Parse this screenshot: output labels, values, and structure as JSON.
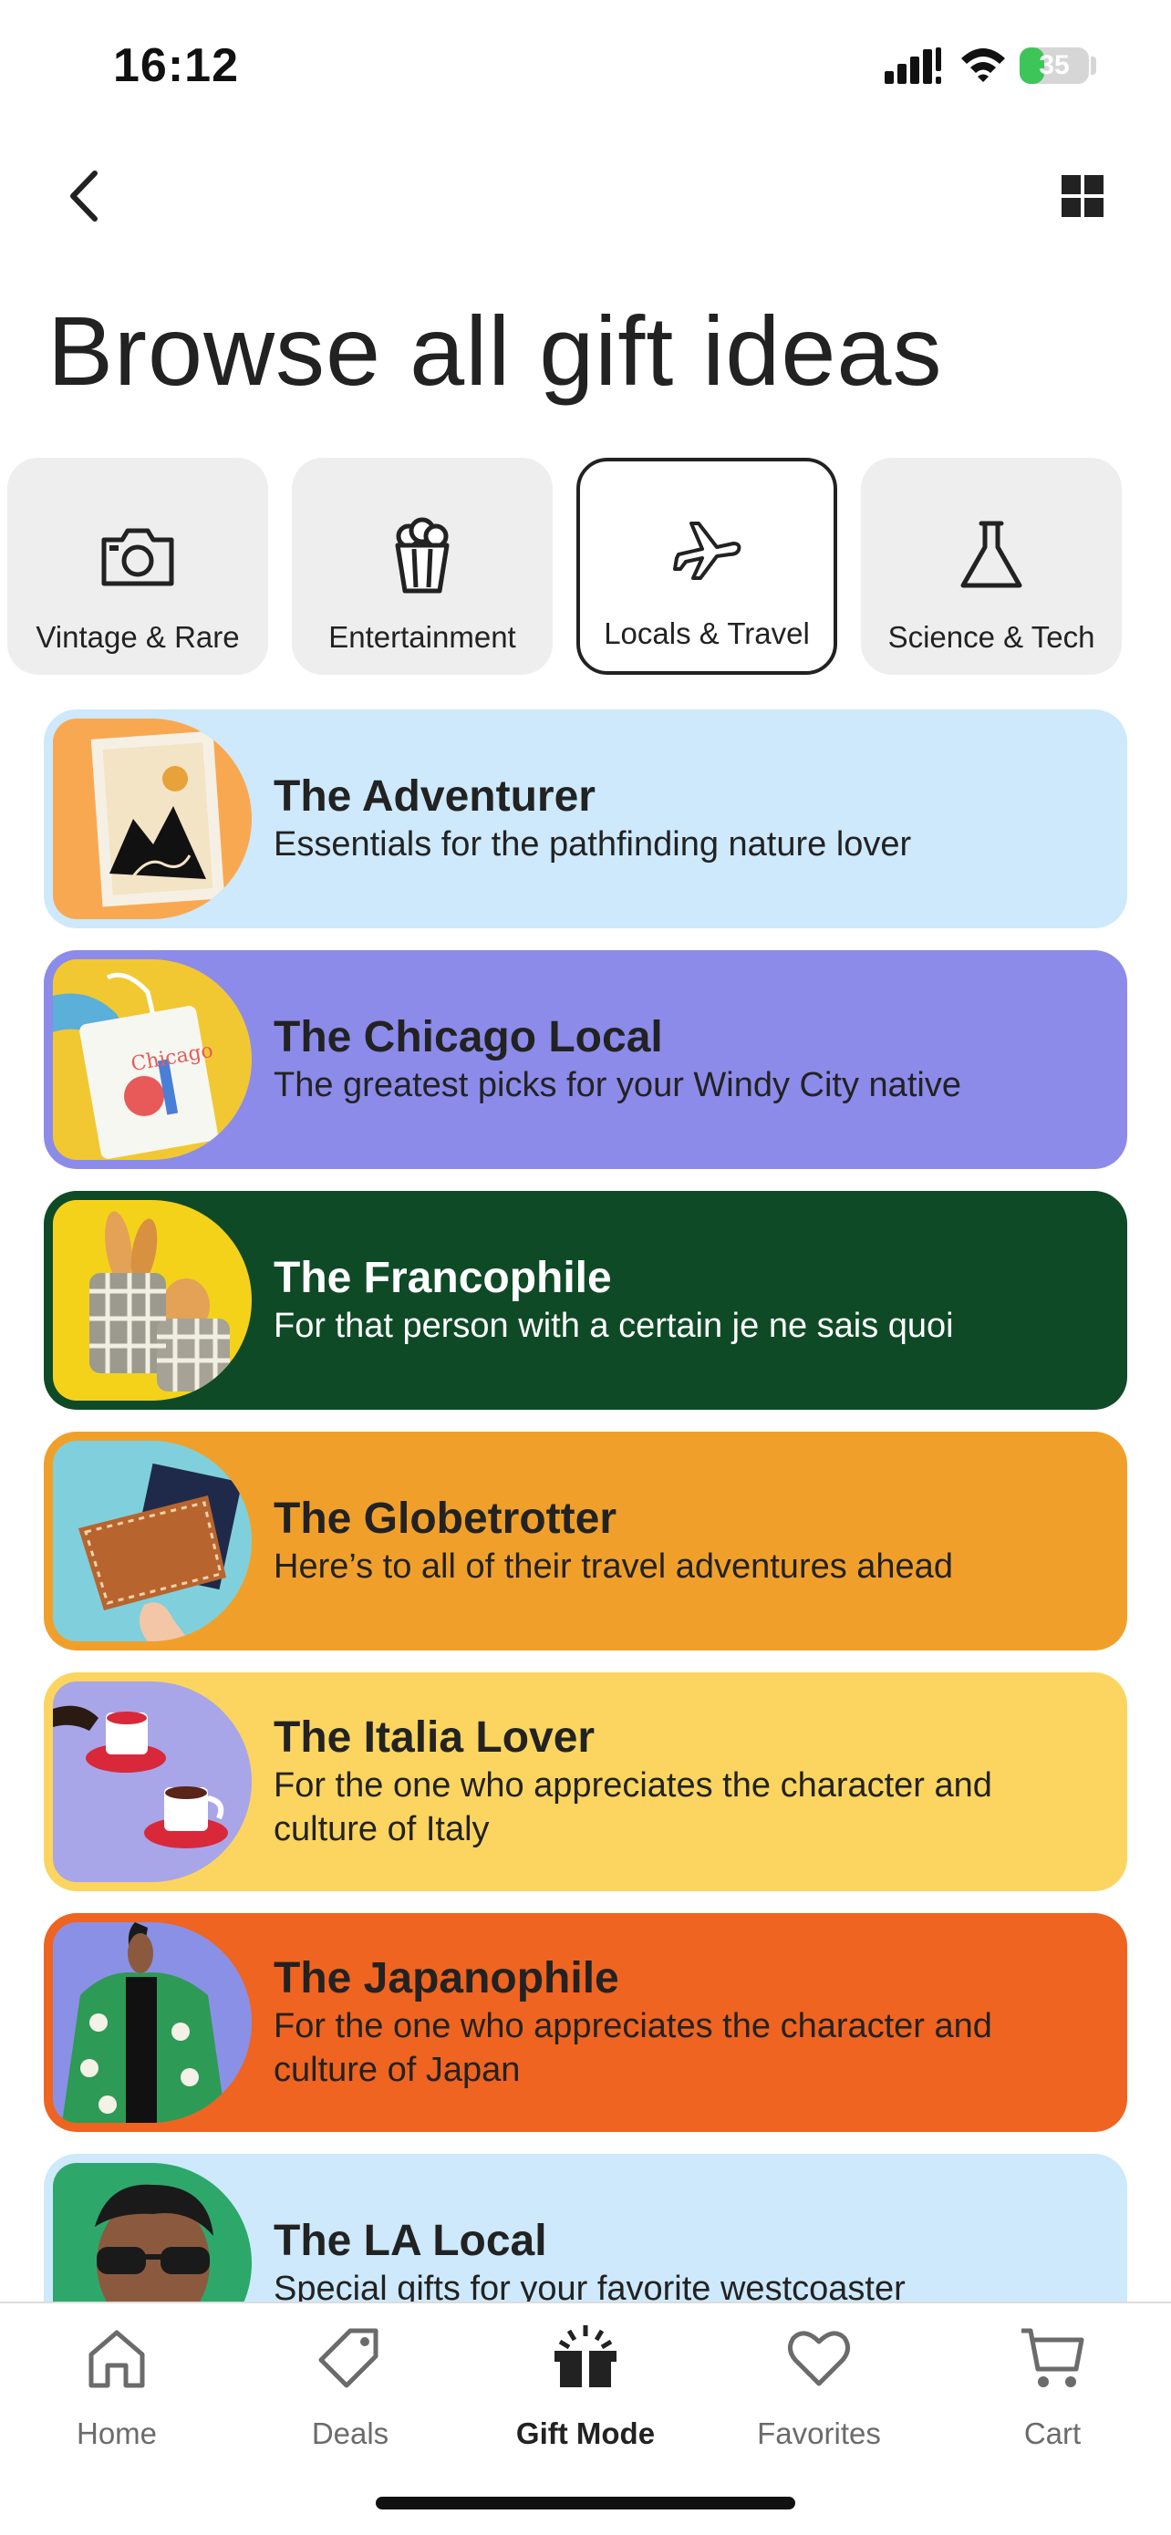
{
  "status_bar": {
    "time": "16:12",
    "battery": "35",
    "battery_level": 0.35
  },
  "header": {
    "back_icon": "chevron-left-icon",
    "grid_icon": "grid-icon",
    "title": "Browse all gift ideas"
  },
  "categories": [
    {
      "label": "Vintage & Rare",
      "icon": "camera-icon",
      "selected": false
    },
    {
      "label": "Entertainment",
      "icon": "popcorn-icon",
      "selected": false
    },
    {
      "label": "Locals & Travel",
      "icon": "airplane-icon",
      "selected": true
    },
    {
      "label": "Science & Tech",
      "icon": "flask-icon",
      "selected": false
    }
  ],
  "collections": [
    {
      "title": "The Adventurer",
      "subtitle": "Essentials for the pathfinding nature lover",
      "bg": "#cde9fb",
      "text_color": "#222222"
    },
    {
      "title": "The Chicago Local",
      "subtitle": "The greatest picks for your Windy City native",
      "bg": "#8c8bea",
      "text_color": "#222222"
    },
    {
      "title": "The Francophile",
      "subtitle": "For that person with a certain je ne sais quoi",
      "bg": "#0f4a27",
      "text_color": "#ffffff"
    },
    {
      "title": "The Globetrotter",
      "subtitle": "Here’s to all of their travel adventures ahead",
      "bg": "#f0a02a",
      "text_color": "#222222"
    },
    {
      "title": "The Italia Lover",
      "subtitle": "For the one who appreciates the character and culture of Italy",
      "bg": "#fbd560",
      "text_color": "#222222"
    },
    {
      "title": "The Japanophile",
      "subtitle": "For the one who appreciates the character and culture of Japan",
      "bg": "#ef6420",
      "text_color": "#222222"
    },
    {
      "title": "The LA Local",
      "subtitle": "Special gifts for your favorite westcoaster",
      "bg": "#cde9fb",
      "text_color": "#222222"
    }
  ],
  "tabs": [
    {
      "label": "Home",
      "icon": "home-icon",
      "active": false
    },
    {
      "label": "Deals",
      "icon": "tag-icon",
      "active": false
    },
    {
      "label": "Gift Mode",
      "icon": "gift-icon",
      "active": true
    },
    {
      "label": "Favorites",
      "icon": "heart-icon",
      "active": false
    },
    {
      "label": "Cart",
      "icon": "cart-icon",
      "active": false
    }
  ]
}
